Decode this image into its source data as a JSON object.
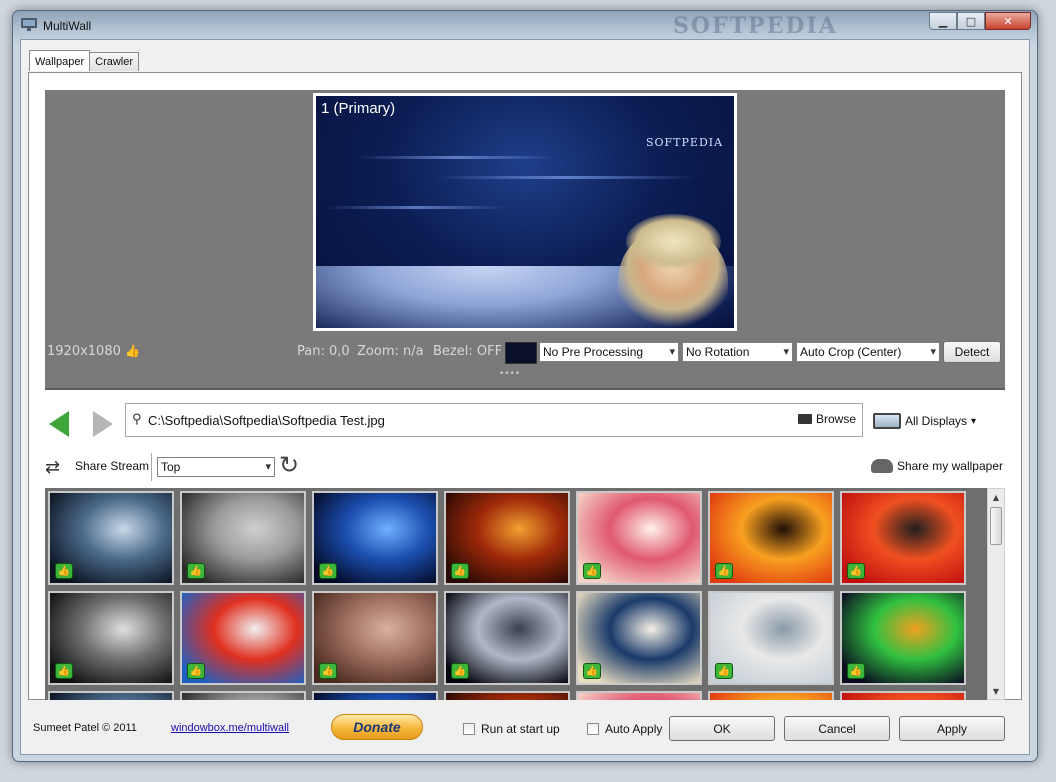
{
  "window": {
    "title": "MultiWall",
    "watermark": "SOFTPEDIA",
    "controls": {
      "minimize": "▁",
      "maximize": "□",
      "close": "✕"
    }
  },
  "tabs": [
    {
      "label": "Wallpaper",
      "active": true
    },
    {
      "label": "Crawler",
      "active": false
    }
  ],
  "preview": {
    "monitor_label": "1 (Primary)",
    "logo_text": "SOFTPEDIA",
    "resolution": "1920x1080",
    "pan": "Pan: 0,0",
    "zoom": "Zoom: n/a",
    "bezel": "Bezel: OFF",
    "bg_color": "#0a0f2a",
    "pre_processing": "No Pre Processing",
    "rotation": "No Rotation",
    "crop": "Auto Crop (Center)",
    "detect_label": "Detect"
  },
  "nav": {
    "path": "C:\\Softpedia\\Softpedia\\Softpedia Test.jpg",
    "browse_label": "Browse",
    "displays_label": "All Displays"
  },
  "stream": {
    "share_stream_label": "Share Stream",
    "sort": "Top",
    "share_wallpaper_label": "Share my wallpaper"
  },
  "thumbnails": [
    {
      "name": "earth-horizon",
      "colors": [
        "#0b1220",
        "#4a6a8a",
        "#c8d8e8"
      ]
    },
    {
      "name": "man-in-coat",
      "colors": [
        "#2a2a2a",
        "#9a9a9a",
        "#d0d0d0"
      ]
    },
    {
      "name": "blue-planet",
      "colors": [
        "#030a28",
        "#1c4fb0",
        "#6fb0ff"
      ]
    },
    {
      "name": "fire-demon",
      "colors": [
        "#2a0a05",
        "#a02a0a",
        "#f0a030"
      ]
    },
    {
      "name": "lily-flower",
      "colors": [
        "#f4d4c8",
        "#e05870",
        "#fff2ea"
      ]
    },
    {
      "name": "tree-sunset",
      "colors": [
        "#e03a10",
        "#f8a020",
        "#201008"
      ]
    },
    {
      "name": "armored-warrior",
      "colors": [
        "#c01010",
        "#f05020",
        "#202020"
      ]
    },
    {
      "name": "typewriter",
      "colors": [
        "#101010",
        "#707070",
        "#e0e0e0"
      ]
    },
    {
      "name": "paint-swirl",
      "colors": [
        "#2060c0",
        "#e03020",
        "#f0f0f0"
      ]
    },
    {
      "name": "wreckage",
      "colors": [
        "#4a2a20",
        "#a07060",
        "#d8b0a0"
      ]
    },
    {
      "name": "star-destroyer",
      "colors": [
        "#05070f",
        "#b0b8c8",
        "#3a4050"
      ]
    },
    {
      "name": "great-wave",
      "colors": [
        "#e8dcc0",
        "#1a3a6a",
        "#f5f0e5"
      ]
    },
    {
      "name": "taj-mahal",
      "colors": [
        "#c8d0d8",
        "#e8e8e8",
        "#8a9aa8"
      ]
    },
    {
      "name": "color-spectrum",
      "colors": [
        "#0a0a20",
        "#30c040",
        "#f0a020"
      ]
    }
  ],
  "footer": {
    "copyright": "Sumeet Patel © 2011",
    "link": "windowbox.me/multiwall",
    "donate_label": "Donate",
    "run_at_startup": "Run at start up",
    "auto_apply": "Auto Apply",
    "ok_label": "OK",
    "cancel_label": "Cancel",
    "apply_label": "Apply"
  },
  "icons": {
    "shuffle": "⇄",
    "refresh": "↻",
    "search": "🔍",
    "thumbs_up": "👍",
    "dropdown": "▾"
  }
}
